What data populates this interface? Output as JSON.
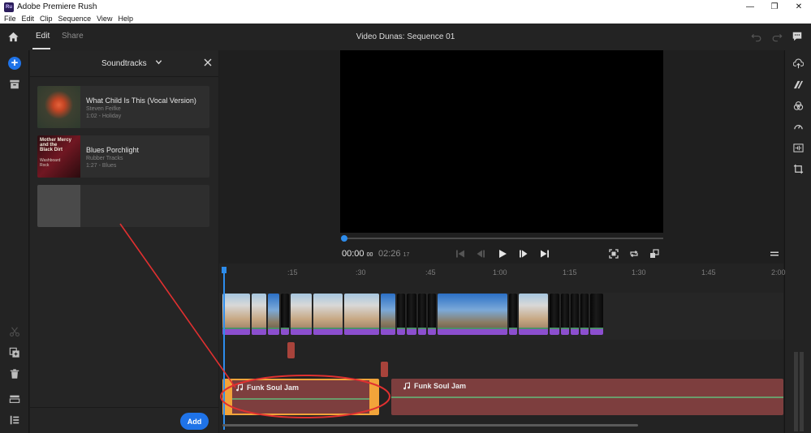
{
  "window": {
    "logo_text": "Ru",
    "title": "Adobe Premiere Rush",
    "minimize": "—",
    "restore": "❐",
    "close": "✕"
  },
  "menu": [
    "File",
    "Edit",
    "Clip",
    "Sequence",
    "View",
    "Help"
  ],
  "header": {
    "tabs": [
      {
        "label": "Edit",
        "active": true
      },
      {
        "label": "Share",
        "active": false
      }
    ],
    "sequence_title": "Video Dunas: Sequence 01",
    "icons": [
      "home-icon",
      "undo-icon",
      "redo-icon",
      "chat-icon"
    ]
  },
  "left_tools": {
    "add": "+",
    "icons": [
      "plus-circle-icon",
      "media-icon",
      "scissors-icon",
      "duplicate-icon",
      "trash-icon",
      "track-icon",
      "list-icon"
    ]
  },
  "soundtracks_panel": {
    "title": "Soundtracks",
    "tracks": [
      {
        "title": "What Child Is This (Vocal Version)",
        "artist": "Steven Feifke",
        "meta": "1:02 - Holiday"
      },
      {
        "title": "Blues Porchlight",
        "artist": "Rubber Tracks",
        "meta": "1:27 - Blues",
        "thumb_lines": [
          "Mother Mercy",
          "and the",
          "Black Dirt"
        ],
        "thumb_sub": [
          "Washboard",
          "Rock"
        ]
      },
      {
        "title": "",
        "artist": "",
        "meta": ""
      }
    ],
    "add_label": "Add"
  },
  "player": {
    "timecode_current": "00:00",
    "timecode_current_frames": "00",
    "timecode_total": "02:26",
    "timecode_total_frames": "17",
    "progress_fraction": 0.0
  },
  "timeline": {
    "ruler_labels": [
      ":15",
      ":30",
      ":45",
      "1:00",
      "1:15",
      "1:30",
      "1:45",
      "2:00"
    ],
    "music_clips": [
      {
        "label": "Funk Soul Jam",
        "selected": true
      },
      {
        "label": "Funk Soul Jam",
        "selected": false
      }
    ]
  },
  "right_tools": {
    "icons": [
      "export-icon",
      "transition-icon",
      "color-icon",
      "speed-icon",
      "audio-icon",
      "crop-icon"
    ]
  },
  "colors": {
    "accent": "#1f73e8",
    "playhead": "#2d8ceb",
    "music_clip": "#7d3e3e",
    "selection": "#f2a43a",
    "annotation": "#e03030"
  }
}
